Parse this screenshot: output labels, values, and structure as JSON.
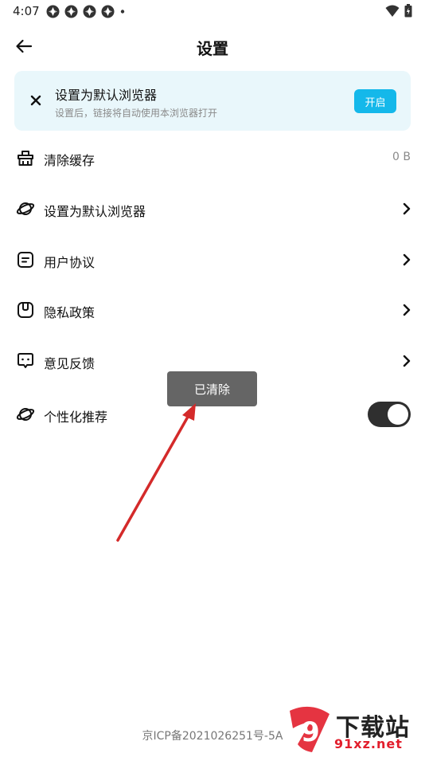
{
  "status_bar": {
    "time": "4:07",
    "icons": [
      "notification-icon",
      "notification-icon",
      "notification-icon",
      "notification-icon",
      "dot-icon",
      "wifi-icon",
      "battery-icon"
    ]
  },
  "header": {
    "title": "设置",
    "back_icon": "arrow-left-icon"
  },
  "banner": {
    "title": "设置为默认浏览器",
    "subtitle": "设置后，链接将自动使用本浏览器打开",
    "button_label": "开启",
    "close_icon": "close-icon",
    "background": "#e9f7fb",
    "accent": "#14b8ea"
  },
  "menu": {
    "items": [
      {
        "label": "清除缓存",
        "value": "0 B",
        "icon": "broom-icon"
      },
      {
        "label": "设置为默认浏览器",
        "icon": "planet-icon"
      },
      {
        "label": "用户协议",
        "icon": "document-icon"
      },
      {
        "label": "隐私政策",
        "icon": "privacy-icon"
      },
      {
        "label": "意见反馈",
        "icon": "feedback-icon"
      },
      {
        "label": "个性化推荐",
        "icon": "planet-icon",
        "toggle_on": true
      }
    ]
  },
  "toast": {
    "text": "已清除"
  },
  "footer": {
    "icp": "京ICP备2021026251号-5A"
  },
  "watermark": {
    "top": "下载站",
    "bottom": "91xz.net",
    "number": "9"
  }
}
